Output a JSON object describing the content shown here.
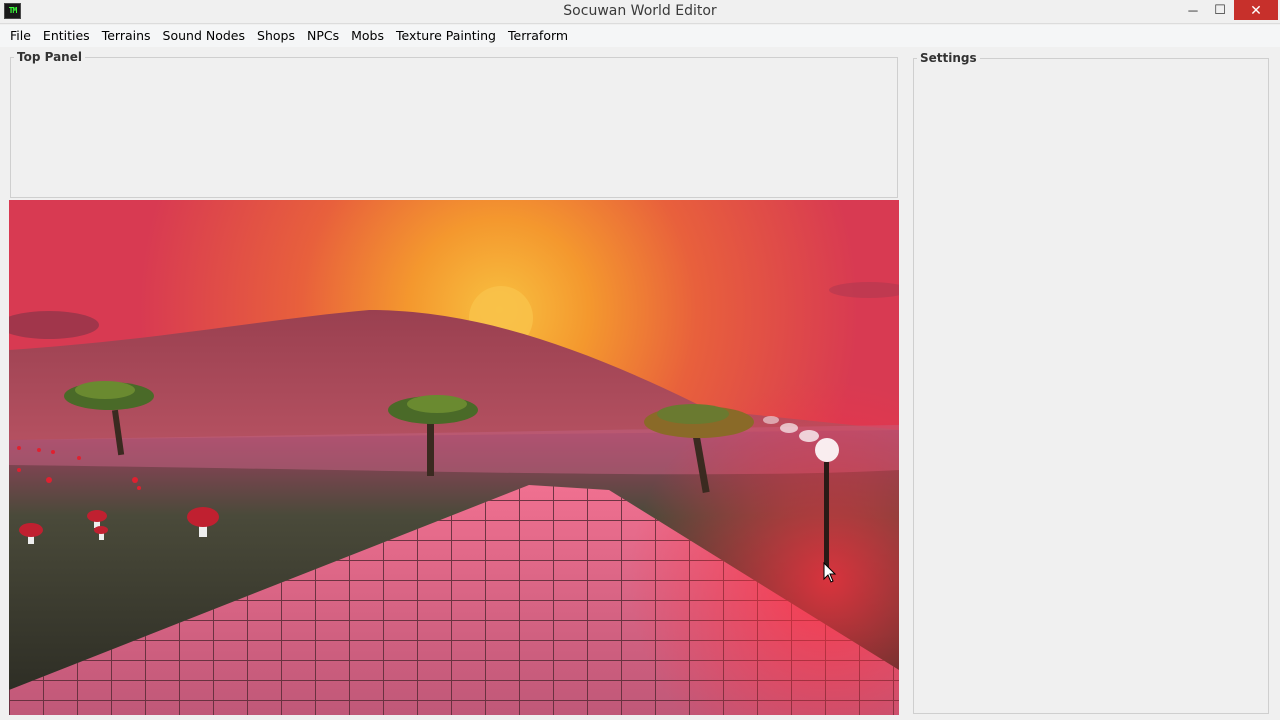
{
  "window": {
    "title": "Socuwan World Editor",
    "app_icon_text": "TM",
    "minimize_glyph": "─",
    "maximize_glyph": "☐",
    "close_glyph": "✕"
  },
  "menu": {
    "items": [
      {
        "label": "File"
      },
      {
        "label": "Entities"
      },
      {
        "label": "Terrains"
      },
      {
        "label": "Sound Nodes"
      },
      {
        "label": "Shops"
      },
      {
        "label": "NPCs"
      },
      {
        "label": "Mobs"
      },
      {
        "label": "Texture Painting"
      },
      {
        "label": "Terraform"
      }
    ]
  },
  "top_panel": {
    "title": "Top Panel"
  },
  "settings_panel": {
    "title": "Settings"
  },
  "viewport": {
    "scene": "sunset-hill-with-stone-path",
    "sky_color": "#e0405a",
    "sun_color": "#f5a030",
    "path_color": "#e0607a"
  },
  "icons": {
    "app": "app-icon",
    "minimize": "minimize-icon",
    "maximize": "maximize-icon",
    "close": "close-icon",
    "cursor": "mouse-cursor-icon"
  }
}
